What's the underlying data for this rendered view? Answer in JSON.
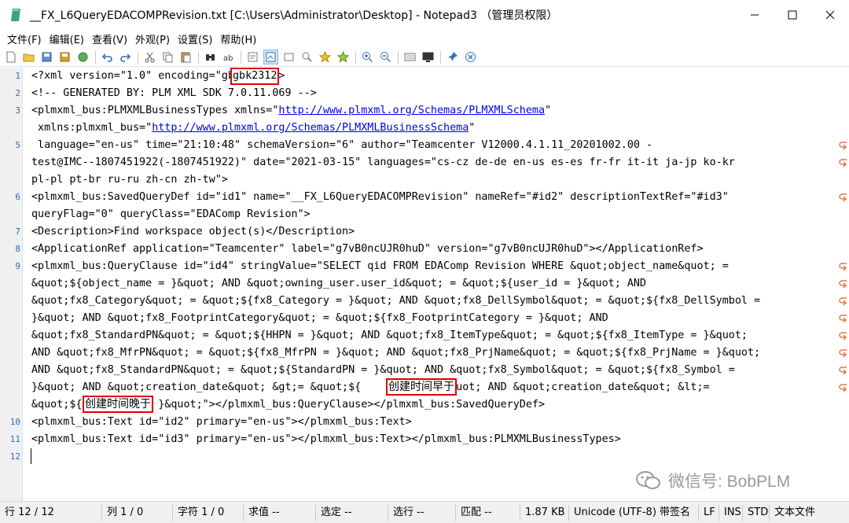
{
  "window": {
    "title": "__FX_L6QueryEDACOMPRevision.txt [C:\\Users\\Administrator\\Desktop] - Notepad3 （管理员权限）"
  },
  "menu": [
    "文件(F)",
    "编辑(E)",
    "查看(V)",
    "外观(P)",
    "设置(S)",
    "帮助(H)"
  ],
  "toolbar_icons": [
    "new-file-icon",
    "open-folder-icon",
    "save-icon",
    "save-as-icon",
    "browse-icon",
    "undo-icon",
    "redo-icon",
    "cut-icon",
    "copy-icon",
    "paste-icon",
    "find-icon",
    "replace-icon",
    "word-wrap-icon",
    "long-line-icon",
    "view-whitespace-icon",
    "zoom-fit-icon",
    "star-icon",
    "star-all-icon",
    "zoom-in-icon",
    "zoom-out-icon",
    "schemes-icon",
    "monitor-icon",
    "pin-icon",
    "close-icon"
  ],
  "lines": [
    {
      "num": "1",
      "text": "<?xml version=\"1.0\" encoding=\"gbk2312\"?>"
    },
    {
      "num": "2",
      "text": "<!-- GENERATED BY: PLM XML SDK 7.0.11.069 -->"
    },
    {
      "num": "3",
      "pre": "<plmxml_bus:PLMXMLBusinessTypes xmlns=\"",
      "link": "http://www.plmxml.org/Schemas/PLMXMLSchema",
      "post": "\""
    },
    {
      "num": "",
      "pre": " xmlns:plmxml_bus=\"",
      "link": "http://www.plmxml.org/Schemas/PLMXMLBusinessSchema",
      "post": "\""
    },
    {
      "num": "5",
      "text": " language=\"en-us\" time=\"21:10:48\" schemaVersion=\"6\" author=\"Teamcenter V12000.4.1.11_20201002.00 -",
      "wrap": true
    },
    {
      "num": "",
      "text": "test@IMC--1807451922(-1807451922)\" date=\"2021-03-15\" languages=\"cs-cz de-de en-us es-es fr-fr it-it ja-jp ko-kr",
      "wrap": true
    },
    {
      "num": "",
      "text": "pl-pl pt-br ru-ru zh-cn zh-tw\">"
    },
    {
      "num": "6",
      "text": "<plmxml_bus:SavedQueryDef id=\"id1\" name=\"__FX_L6QueryEDACOMPRevision\" nameRef=\"#id2\" descriptionTextRef=\"#id3\"",
      "wrap": true
    },
    {
      "num": "",
      "text": "queryFlag=\"0\" queryClass=\"EDAComp Revision\">"
    },
    {
      "num": "7",
      "text": "<Description>Find workspace object(s)</Description>"
    },
    {
      "num": "8",
      "text": "<ApplicationRef application=\"Teamcenter\" label=\"g7vB0ncUJR0huD\" version=\"g7vB0ncUJR0huD\"></ApplicationRef>"
    },
    {
      "num": "9",
      "text": "<plmxml_bus:QueryClause id=\"id4\" stringValue=\"SELECT qid FROM EDAComp Revision WHERE &quot;object_name&quot; =",
      "wrap": true
    },
    {
      "num": "",
      "text": "&quot;${object_name = }&quot; AND &quot;owning_user.user_id&quot; = &quot;${user_id = }&quot; AND",
      "wrap": true
    },
    {
      "num": "",
      "text": "&quot;fx8_Category&quot; = &quot;${fx8_Category = }&quot; AND &quot;fx8_DellSymbol&quot; = &quot;${fx8_DellSymbol =",
      "wrap": true
    },
    {
      "num": "",
      "text": "}&quot; AND &quot;fx8_FootprintCategory&quot; = &quot;${fx8_FootprintCategory = }&quot; AND",
      "wrap": true
    },
    {
      "num": "",
      "text": "&quot;fx8_StandardPN&quot; = &quot;${HHPN = }&quot; AND &quot;fx8_ItemType&quot; = &quot;${fx8_ItemType = }&quot;",
      "wrap": true
    },
    {
      "num": "",
      "text": "AND &quot;fx8_MfrPN&quot; = &quot;${fx8_MfrPN = }&quot; AND &quot;fx8_PrjName&quot; = &quot;${fx8_PrjName = }&quot;",
      "wrap": true
    },
    {
      "num": "",
      "text": "AND &quot;fx8_StandardPN&quot; = &quot;${StandardPN = }&quot; AND &quot;fx8_Symbol&quot; = &quot;${fx8_Symbol =",
      "wrap": true
    },
    {
      "num": "",
      "text": "}&quot; AND &quot;creation_date&quot; &gt;= &quot;${          = }&quot; AND &quot;creation_date&quot; &lt;=",
      "wrap": true
    },
    {
      "num": "",
      "text": "&quot;${          = }&quot;\"></plmxml_bus:QueryClause></plmxml_bus:SavedQueryDef>"
    },
    {
      "num": "10",
      "text": "<plmxml_bus:Text id=\"id2\" primary=\"en-us\"></plmxml_bus:Text>"
    },
    {
      "num": "11",
      "text": "<plmxml_bus:Text id=\"id3\" primary=\"en-us\"></plmxml_bus:Text></plmxml_bus:PLMXMLBusinessTypes>"
    },
    {
      "num": "12",
      "text": ""
    }
  ],
  "annotations": {
    "encoding": "gbk2312",
    "created_after": "创建时间早于",
    "created_before": "创建时间晚于"
  },
  "watermark": {
    "text": "微信号: BobPLM"
  },
  "status": [
    "行 12 / 12",
    "列 1 / 0",
    "字符 1 / 0",
    "求值 --",
    "选定 --",
    "选行 --",
    "匹配 --",
    "1.87 KB",
    "Unicode (UTF-8) 带签名",
    "LF",
    "INS",
    "STD",
    "文本文件"
  ]
}
